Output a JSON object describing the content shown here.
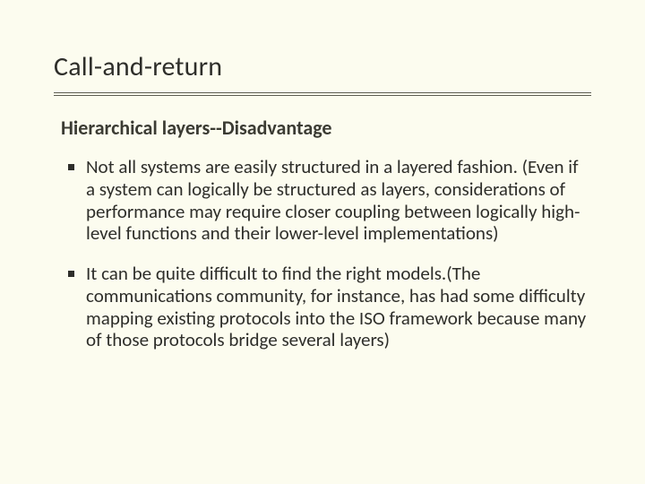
{
  "title": "Call-and-return",
  "subtitle": "Hierarchical layers--Disadvantage",
  "bullets": [
    "Not all systems are easily structured in a layered fashion. (Even if a system can logically be structured as layers, considerations of performance may require closer coupling between logically high-level functions and their lower-level implementations)",
    "It can be quite difficult to find the right models.(The communications community, for instance, has had some difficulty mapping existing protocols into the ISO framework because many of those protocols bridge several layers)"
  ]
}
